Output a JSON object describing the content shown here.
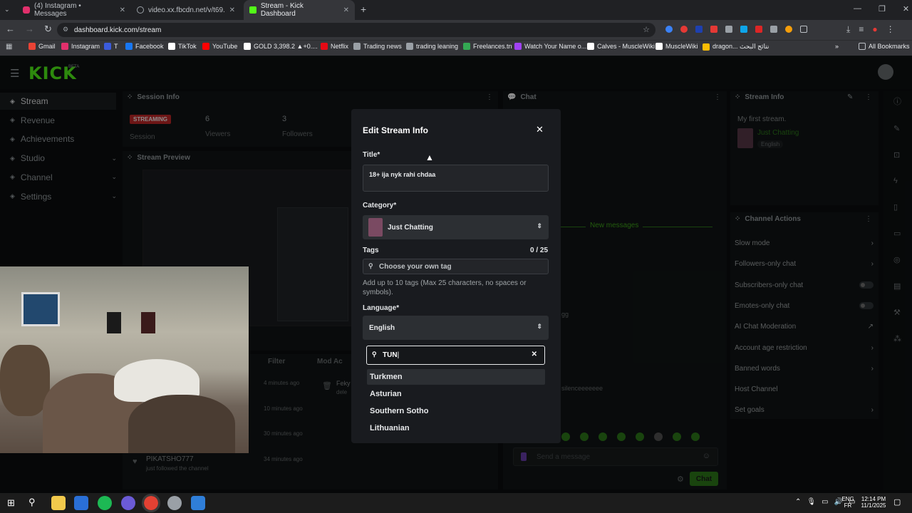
{
  "browser": {
    "tabs": [
      {
        "label": "(4) Instagram • Messages",
        "color": "#e1306c"
      },
      {
        "label": "video.xx.fbcdn.net/v/t69.45643",
        "color": "#9aa0a6"
      },
      {
        "label": "Stream - Kick Dashboard",
        "color": "#53fc18"
      }
    ],
    "url": "dashboard.kick.com/stream",
    "bookmarks": [
      {
        "label": "Gmail",
        "color": "#ea4335"
      },
      {
        "label": "Instagram",
        "color": "#e1306c"
      },
      {
        "label": "T",
        "color": "#3b5bdb"
      },
      {
        "label": "Facebook",
        "color": "#1877f2"
      },
      {
        "label": "TikTok",
        "color": "#ffffff"
      },
      {
        "label": "YouTube",
        "color": "#ff0000"
      },
      {
        "label": "GOLD 3,398.2 ▲+0....",
        "color": "#ffffff"
      },
      {
        "label": "Netflix",
        "color": "#e50914"
      },
      {
        "label": "Trading news",
        "color": "#9aa0a6"
      },
      {
        "label": "trading leaning",
        "color": "#9aa0a6"
      },
      {
        "label": "Freelances.tn",
        "color": "#34a853"
      },
      {
        "label": "Watch Your Name o...",
        "color": "#a142f4"
      },
      {
        "label": "Calves - MuscleWiki",
        "color": "#ffffff"
      },
      {
        "label": "MuscleWiki",
        "color": "#ffffff"
      },
      {
        "label": "dragon... نتائج البحث",
        "color": "#fbbc04"
      }
    ],
    "all_bookmarks": "All Bookmarks"
  },
  "kick": {
    "logo": "KICK",
    "beta": "BETA",
    "nav": [
      {
        "label": "Stream",
        "icon": "stream-icon",
        "chevron": false
      },
      {
        "label": "Revenue",
        "icon": "revenue-icon",
        "chevron": false
      },
      {
        "label": "Achievements",
        "icon": "achievements-icon",
        "chevron": false
      },
      {
        "label": "Studio",
        "icon": "studio-icon",
        "chevron": true
      },
      {
        "label": "Channel",
        "icon": "channel-icon",
        "chevron": true
      },
      {
        "label": "Settings",
        "icon": "settings-icon",
        "chevron": true
      }
    ],
    "session": {
      "title": "Session Info",
      "status": "STREAMING",
      "status_sub": "Session",
      "viewers": "6",
      "viewers_label": "Viewers",
      "followers": "3",
      "followers_label": "Followers"
    },
    "preview_title": "Stream Preview",
    "chat": {
      "title": "Chat",
      "new_messages": "New messages",
      "snippet1": "gg",
      "snippet2": "silenceeeeeee",
      "placeholder": "Send a message",
      "send": "Chat"
    },
    "mod": {
      "filter": "Filter",
      "mod_actions": "Mod Ac",
      "times": [
        "4 minutes ago",
        "10 minutes ago",
        "30 minutes ago",
        "34 minutes ago"
      ],
      "entry_name": "Feky",
      "entry_sub": "dele",
      "follower_name": "PIKATSHO777",
      "follower_sub": "just followed the channel"
    },
    "stream_info": {
      "title": "Stream Info",
      "stream_title": "My first stream.",
      "category": "Just Chatting",
      "language": "English"
    },
    "channel_actions": {
      "title": "Channel Actions",
      "items": [
        {
          "label": "Slow mode",
          "control": "chevron"
        },
        {
          "label": "Followers-only chat",
          "control": "chevron"
        },
        {
          "label": "Subscribers-only chat",
          "control": "toggle"
        },
        {
          "label": "Emotes-only chat",
          "control": "toggle"
        },
        {
          "label": "AI Chat Moderation",
          "control": "external"
        },
        {
          "label": "Account age restriction",
          "control": "chevron"
        },
        {
          "label": "Banned words",
          "control": "chevron"
        },
        {
          "label": "Host Channel",
          "control": "none"
        },
        {
          "label": "Set goals",
          "control": "chevron"
        }
      ]
    }
  },
  "modal": {
    "title": "Edit Stream Info",
    "title_label": "Title*",
    "title_value": "18+ ija nyk rahi chdaa",
    "category_label": "Category*",
    "category_value": "Just Chatting",
    "tags_label": "Tags",
    "tags_count": "0 / 25",
    "tags_placeholder": "Choose your own tag",
    "tags_help": "Add up to 10 tags (Max 25 characters, no spaces or symbols).",
    "language_label": "Language*",
    "language_value": "English",
    "search_value": "TUN",
    "options": [
      "Turkmen",
      "Asturian",
      "Southern Sotho",
      "Lithuanian"
    ]
  },
  "taskbar": {
    "lang": "ENG",
    "lang_sub": "FR",
    "time": "12:14 PM",
    "date": "11/1/2025"
  }
}
